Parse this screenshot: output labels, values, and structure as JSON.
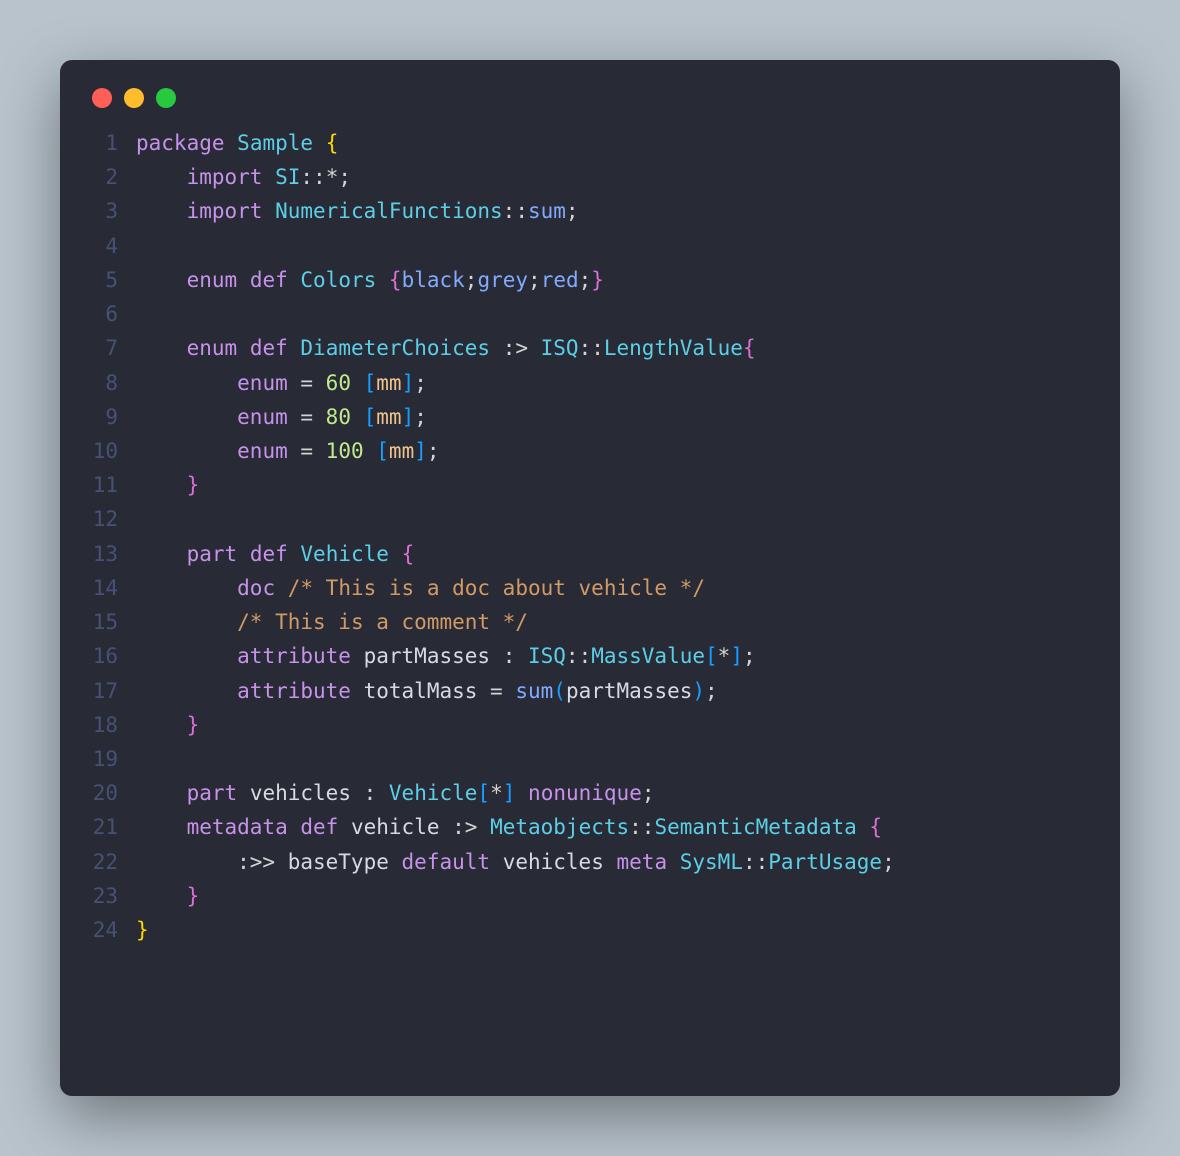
{
  "window": {
    "buttons": [
      "close",
      "minimize",
      "zoom"
    ]
  },
  "code": {
    "lines": [
      {
        "n": 1,
        "tokens": [
          [
            "kw",
            "package"
          ],
          [
            "punc",
            " "
          ],
          [
            "type",
            "Sample"
          ],
          [
            "punc",
            " "
          ],
          [
            "brace",
            "{"
          ]
        ]
      },
      {
        "n": 2,
        "tokens": [
          [
            "punc",
            "    "
          ],
          [
            "kw",
            "import"
          ],
          [
            "punc",
            " "
          ],
          [
            "type",
            "SI"
          ],
          [
            "dcolon",
            "::"
          ],
          [
            "punc",
            "*"
          ],
          [
            "punc",
            ";"
          ]
        ]
      },
      {
        "n": 3,
        "tokens": [
          [
            "punc",
            "    "
          ],
          [
            "kw",
            "import"
          ],
          [
            "punc",
            " "
          ],
          [
            "type",
            "NumericalFunctions"
          ],
          [
            "dcolon",
            "::"
          ],
          [
            "func",
            "sum"
          ],
          [
            "punc",
            ";"
          ]
        ]
      },
      {
        "n": 4,
        "tokens": [
          [
            "punc",
            ""
          ]
        ]
      },
      {
        "n": 5,
        "tokens": [
          [
            "punc",
            "    "
          ],
          [
            "kw",
            "enum"
          ],
          [
            "punc",
            " "
          ],
          [
            "kw",
            "def"
          ],
          [
            "punc",
            " "
          ],
          [
            "type",
            "Colors"
          ],
          [
            "punc",
            " "
          ],
          [
            "brace2",
            "{"
          ],
          [
            "func",
            "black"
          ],
          [
            "punc",
            ";"
          ],
          [
            "func",
            "grey"
          ],
          [
            "punc",
            ";"
          ],
          [
            "func",
            "red"
          ],
          [
            "punc",
            ";"
          ],
          [
            "brace2",
            "}"
          ]
        ]
      },
      {
        "n": 6,
        "tokens": [
          [
            "punc",
            ""
          ]
        ]
      },
      {
        "n": 7,
        "tokens": [
          [
            "punc",
            "    "
          ],
          [
            "kw",
            "enum"
          ],
          [
            "punc",
            " "
          ],
          [
            "kw",
            "def"
          ],
          [
            "punc",
            " "
          ],
          [
            "type",
            "DiameterChoices"
          ],
          [
            "punc",
            " :> "
          ],
          [
            "type",
            "ISQ"
          ],
          [
            "dcolon",
            "::"
          ],
          [
            "type",
            "LengthValue"
          ],
          [
            "brace2",
            "{"
          ]
        ]
      },
      {
        "n": 8,
        "tokens": [
          [
            "punc",
            "        "
          ],
          [
            "kw",
            "enum"
          ],
          [
            "punc",
            " = "
          ],
          [
            "num",
            "60"
          ],
          [
            "punc",
            " "
          ],
          [
            "brack",
            "["
          ],
          [
            "unit",
            "mm"
          ],
          [
            "brack",
            "]"
          ],
          [
            "punc",
            ";"
          ]
        ]
      },
      {
        "n": 9,
        "tokens": [
          [
            "punc",
            "        "
          ],
          [
            "kw",
            "enum"
          ],
          [
            "punc",
            " = "
          ],
          [
            "num",
            "80"
          ],
          [
            "punc",
            " "
          ],
          [
            "brack",
            "["
          ],
          [
            "unit",
            "mm"
          ],
          [
            "brack",
            "]"
          ],
          [
            "punc",
            ";"
          ]
        ]
      },
      {
        "n": 10,
        "tokens": [
          [
            "punc",
            "        "
          ],
          [
            "kw",
            "enum"
          ],
          [
            "punc",
            " = "
          ],
          [
            "num",
            "100"
          ],
          [
            "punc",
            " "
          ],
          [
            "brack",
            "["
          ],
          [
            "unit",
            "mm"
          ],
          [
            "brack",
            "]"
          ],
          [
            "punc",
            ";"
          ]
        ]
      },
      {
        "n": 11,
        "tokens": [
          [
            "punc",
            "    "
          ],
          [
            "brace2",
            "}"
          ]
        ]
      },
      {
        "n": 12,
        "tokens": [
          [
            "punc",
            ""
          ]
        ]
      },
      {
        "n": 13,
        "tokens": [
          [
            "punc",
            "    "
          ],
          [
            "kw",
            "part"
          ],
          [
            "punc",
            " "
          ],
          [
            "kw",
            "def"
          ],
          [
            "punc",
            " "
          ],
          [
            "type",
            "Vehicle"
          ],
          [
            "punc",
            " "
          ],
          [
            "brace2",
            "{"
          ]
        ]
      },
      {
        "n": 14,
        "tokens": [
          [
            "punc",
            "        "
          ],
          [
            "kw",
            "doc"
          ],
          [
            "punc",
            " "
          ],
          [
            "comm",
            "/* This is a doc about vehicle */"
          ]
        ]
      },
      {
        "n": 15,
        "tokens": [
          [
            "punc",
            "        "
          ],
          [
            "comm",
            "/* This is a comment */"
          ]
        ]
      },
      {
        "n": 16,
        "tokens": [
          [
            "punc",
            "        "
          ],
          [
            "kw",
            "attribute"
          ],
          [
            "punc",
            " "
          ],
          [
            "pale",
            "partMasses"
          ],
          [
            "punc",
            " : "
          ],
          [
            "type",
            "ISQ"
          ],
          [
            "dcolon",
            "::"
          ],
          [
            "type",
            "MassValue"
          ],
          [
            "brack",
            "["
          ],
          [
            "punc",
            "*"
          ],
          [
            "brack",
            "]"
          ],
          [
            "punc",
            ";"
          ]
        ]
      },
      {
        "n": 17,
        "tokens": [
          [
            "punc",
            "        "
          ],
          [
            "kw",
            "attribute"
          ],
          [
            "punc",
            " "
          ],
          [
            "pale",
            "totalMass"
          ],
          [
            "punc",
            " = "
          ],
          [
            "func",
            "sum"
          ],
          [
            "brack",
            "("
          ],
          [
            "pale",
            "partMasses"
          ],
          [
            "brack",
            ")"
          ],
          [
            "punc",
            ";"
          ]
        ]
      },
      {
        "n": 18,
        "tokens": [
          [
            "punc",
            "    "
          ],
          [
            "brace2",
            "}"
          ]
        ]
      },
      {
        "n": 19,
        "tokens": [
          [
            "punc",
            ""
          ]
        ]
      },
      {
        "n": 20,
        "tokens": [
          [
            "punc",
            "    "
          ],
          [
            "kw",
            "part"
          ],
          [
            "punc",
            " "
          ],
          [
            "pale",
            "vehicles"
          ],
          [
            "punc",
            " : "
          ],
          [
            "type",
            "Vehicle"
          ],
          [
            "brack",
            "["
          ],
          [
            "punc",
            "*"
          ],
          [
            "brack",
            "]"
          ],
          [
            "punc",
            " "
          ],
          [
            "kw",
            "nonunique"
          ],
          [
            "punc",
            ";"
          ]
        ]
      },
      {
        "n": 21,
        "tokens": [
          [
            "punc",
            "    "
          ],
          [
            "kw",
            "metadata"
          ],
          [
            "punc",
            " "
          ],
          [
            "kw",
            "def"
          ],
          [
            "punc",
            " "
          ],
          [
            "pale",
            "vehicle"
          ],
          [
            "punc",
            " :> "
          ],
          [
            "type",
            "Metaobjects"
          ],
          [
            "dcolon",
            "::"
          ],
          [
            "type",
            "SemanticMetadata"
          ],
          [
            "punc",
            " "
          ],
          [
            "brace2",
            "{"
          ]
        ]
      },
      {
        "n": 22,
        "tokens": [
          [
            "punc",
            "        :>> "
          ],
          [
            "pale",
            "baseType"
          ],
          [
            "punc",
            " "
          ],
          [
            "kw",
            "default"
          ],
          [
            "punc",
            " "
          ],
          [
            "pale",
            "vehicles"
          ],
          [
            "punc",
            " "
          ],
          [
            "kw",
            "meta"
          ],
          [
            "punc",
            " "
          ],
          [
            "type",
            "SysML"
          ],
          [
            "dcolon",
            "::"
          ],
          [
            "type",
            "PartUsage"
          ],
          [
            "punc",
            ";"
          ]
        ]
      },
      {
        "n": 23,
        "tokens": [
          [
            "punc",
            "    "
          ],
          [
            "brace2",
            "}"
          ]
        ]
      },
      {
        "n": 24,
        "tokens": [
          [
            "brace",
            "}"
          ]
        ]
      }
    ]
  }
}
